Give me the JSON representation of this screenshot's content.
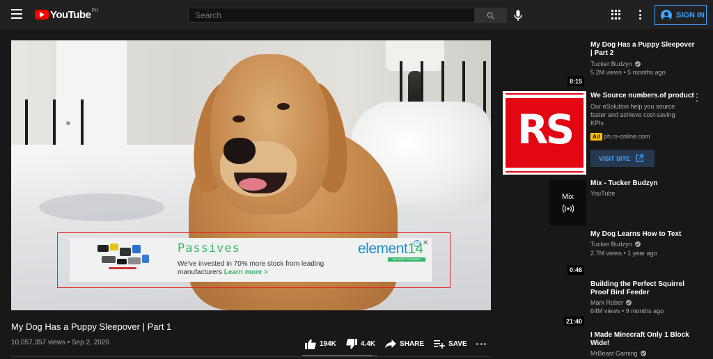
{
  "header": {
    "brand": "YouTube",
    "country_code": "PH",
    "search_placeholder": "Search",
    "signin_label": "SIGN IN"
  },
  "ad_overlay": {
    "headline": "Passives",
    "body": "We've invested in 70% more stock from leading manufacturers",
    "cta": "Learn more >",
    "brand_main": "element",
    "brand_num": "14",
    "brand_tag": "AN AVNET COMPANY",
    "info": "i",
    "close": "✕"
  },
  "video": {
    "title": "My Dog Has a Puppy Sleepover | Part 1",
    "meta": "10,057,357 views • Sep 2, 2020",
    "likes": "194K",
    "dislikes": "4.4K",
    "share_label": "SHARE",
    "save_label": "SAVE",
    "like_ratio": 0.93
  },
  "sidebar": {
    "items": [
      {
        "title": "My Dog Has a Puppy Sleepover | Part 2",
        "channel": "Tucker Budzyn",
        "stats": "5.2M views • 5 months ago",
        "duration": "8:15"
      },
      {
        "title": "Mix - Tucker Budzyn",
        "channel": "YouTube",
        "mix_label": "Mix"
      },
      {
        "title": "My Dog Learns How to Text",
        "channel": "Tucker Budzyn",
        "stats": "2.7M views • 1 year ago",
        "duration": "0:46"
      },
      {
        "title": "Building the Perfect Squirrel Proof Bird Feeder",
        "channel": "Mark Rober",
        "stats": "64M views • 9 months ago",
        "duration": "21:40"
      },
      {
        "title": "I Made Minecraft Only 1 Block Wide!",
        "channel": "MrBeast Gaming"
      }
    ],
    "ad": {
      "logo_text": "RS",
      "title": "We Source numbers.of product",
      "description": "Our eSolution help you source faster and achieve cost-saving KPIs",
      "badge": "Ad",
      "domain": "ph.rs-online.com",
      "visit_label": "VISIT SITE"
    }
  },
  "colors": {
    "background": "#181818",
    "header": "#212121",
    "accent": "#3ea6ff",
    "youtube_red": "#ff0000",
    "rs_red": "#e30613",
    "ad_green": "#38b46a",
    "ad_badge": "#ffbf00"
  }
}
